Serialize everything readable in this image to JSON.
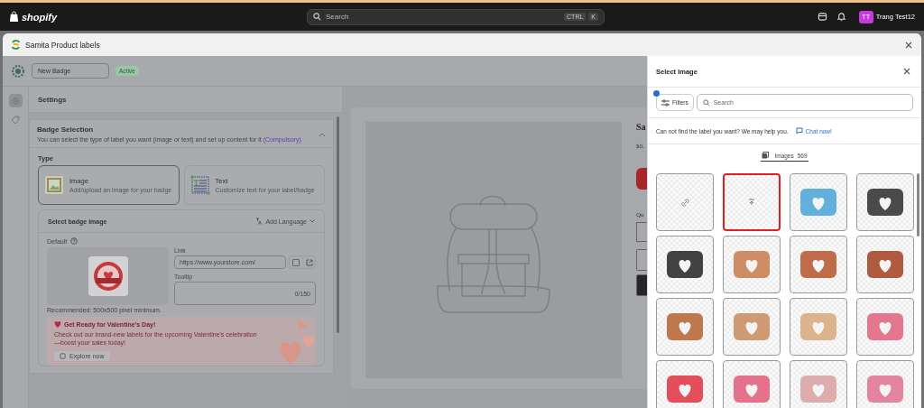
{
  "topbar": {
    "brand": "shopify",
    "search_placeholder": "Search",
    "shortcut_keys": [
      "CTRL",
      "K"
    ],
    "user_initials": "TT",
    "user_name": "Trang Test12"
  },
  "modal": {
    "title": "Samita Product labels"
  },
  "editor": {
    "badge_name": "New Badge",
    "status": "Active",
    "rail_items": [
      {
        "kind": "settings",
        "selected": true
      },
      {
        "kind": "tag",
        "selected": false
      }
    ],
    "settings_title": "Settings",
    "section": {
      "title": "Badge Selection",
      "description": "You can select the type of label you want (image or text) and set up content for it",
      "required_note": "(Compulsory)",
      "expanded": true
    },
    "type_label": "Type",
    "types": [
      {
        "kind": "image",
        "title": "Image",
        "description": "Add/upload an image for your badge",
        "selected": true
      },
      {
        "kind": "text",
        "title": "Text",
        "description": "Customize text for your label/badge",
        "selected": false
      }
    ],
    "image_card": {
      "title": "Select badge image",
      "add_language": "Add Language",
      "default_label": "Default",
      "link_label": "Link",
      "link_value": "https://www.yourstore.com/",
      "open_new_tab": false,
      "tooltip_label": "Tooltip",
      "tooltip_counter": "0/150",
      "recommendation": "Recommended: 500x500 pixel minimum."
    },
    "promo": {
      "title": "Get Ready for Valentine's Day!",
      "text": "Check out our brand-new labels for the upcoming Valentine's celebration—boost your sales today!",
      "button": "Explore now"
    },
    "preview": {
      "product_title": "Sa",
      "price": "$0.",
      "quantity_label": "Qu"
    }
  },
  "select_image": {
    "title": "Select Image",
    "filters_label": "Filters",
    "search_placeholder": "Search",
    "help_text": "Can not find the label you want? We may help you.",
    "chat_link": "Chat now!",
    "tab_label": "Images",
    "tab_count": "569",
    "tiles": [
      {
        "kind": "link",
        "highlighted": false
      },
      {
        "kind": "upload",
        "highlighted": true
      },
      {
        "kind": "image",
        "highlighted": false
      },
      {
        "kind": "image",
        "highlighted": false
      },
      {
        "kind": "image",
        "highlighted": false
      },
      {
        "kind": "image",
        "highlighted": false
      },
      {
        "kind": "image",
        "highlighted": false
      },
      {
        "kind": "image",
        "highlighted": false
      },
      {
        "kind": "image",
        "highlighted": false
      },
      {
        "kind": "image",
        "highlighted": false
      },
      {
        "kind": "image",
        "highlighted": false
      },
      {
        "kind": "image",
        "highlighted": false
      },
      {
        "kind": "image",
        "highlighted": false
      },
      {
        "kind": "image",
        "highlighted": false
      },
      {
        "kind": "image",
        "highlighted": false
      },
      {
        "kind": "image",
        "highlighted": false
      }
    ]
  }
}
